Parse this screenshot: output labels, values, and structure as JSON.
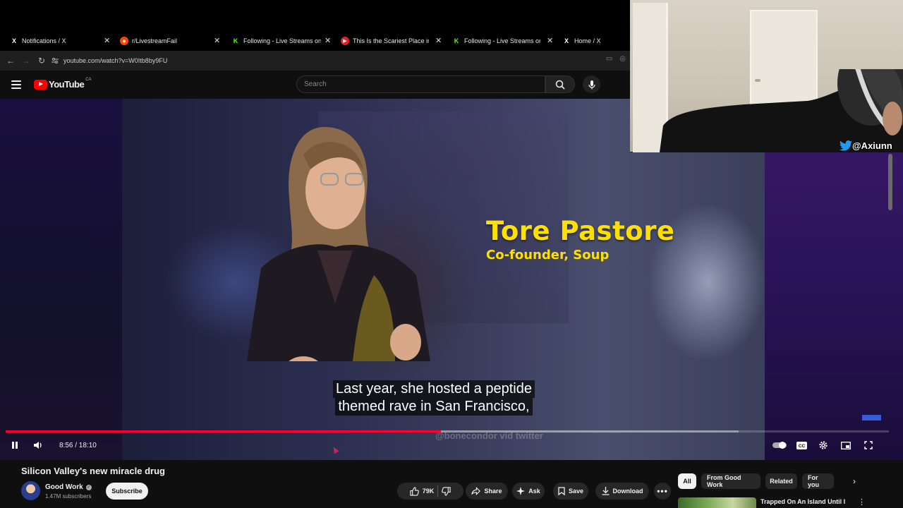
{
  "browser": {
    "tabs": [
      {
        "title": "Notifications / X",
        "favicon": "x-icon"
      },
      {
        "title": "r/LivestreamFail",
        "favicon": "reddit-icon"
      },
      {
        "title": "Following - Live Streams on Kick",
        "favicon": "kick-icon"
      },
      {
        "title": "This Is the Scariest Place in The",
        "favicon": "youtube-icon"
      },
      {
        "title": "Following - Live Streams on Kick",
        "favicon": "kick-icon"
      },
      {
        "title": "Home / X",
        "favicon": "x-icon"
      }
    ],
    "url": "youtube.com/watch?v=W0Itb8by9FU"
  },
  "youtube": {
    "logo_text": "YouTube",
    "region": "CA",
    "search_placeholder": "Search"
  },
  "video": {
    "overlay_name": "Tore Pastore",
    "overlay_role": "Co-founder, Soup",
    "caption_line1": "Last year, she hosted a peptide",
    "caption_line2": "themed rave in San Francisco,",
    "watermark": "@bonecondor vid twitter",
    "current_time": "8:56",
    "duration": "18:10",
    "timecode": "8:56 / 18:10",
    "progress_played": 0.493,
    "progress_loaded": 0.83,
    "title": "Silicon Valley's new miracle drug"
  },
  "channel": {
    "name": "Good Work",
    "subscribers": "1.47M subscribers",
    "subscribe_label": "Subscribe"
  },
  "actions": {
    "likes": "79K",
    "share": "Share",
    "ask": "Ask",
    "save": "Save",
    "download": "Download"
  },
  "filters": [
    "All",
    "From Good Work",
    "Related",
    "For you"
  ],
  "recommendation": {
    "title": "Trapped On An Island Until I"
  },
  "webcam": {
    "handle": "@Axiunn"
  },
  "colors": {
    "accent_red": "#ff0033",
    "name_yellow": "#ffe000",
    "twitter_blue": "#1d9bf0",
    "kick_green": "#53fc18"
  }
}
